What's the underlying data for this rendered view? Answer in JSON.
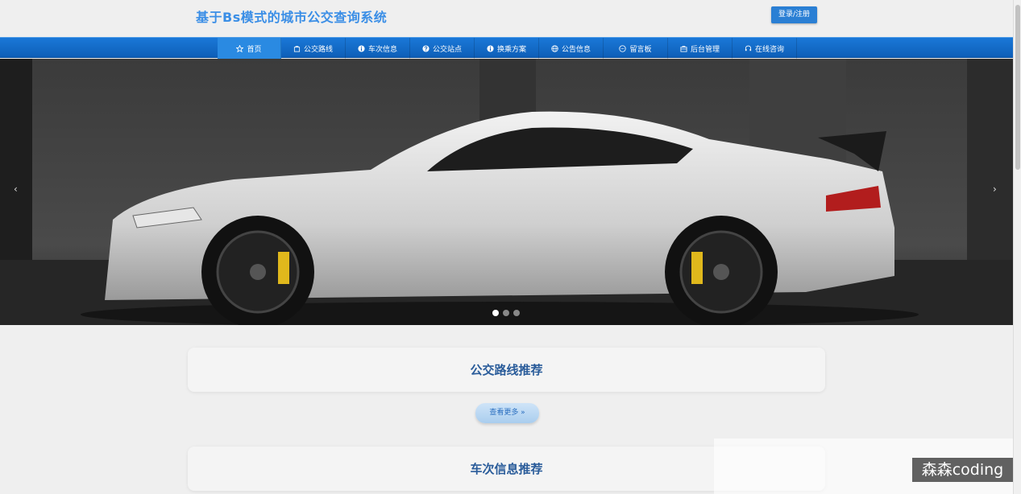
{
  "header": {
    "site_title": "基于Bs模式的城市公交查询系统",
    "login_label": "登录/注册"
  },
  "nav": {
    "items": [
      {
        "label": "首页",
        "icon": "star-icon"
      },
      {
        "label": "公交路线",
        "icon": "bag-icon"
      },
      {
        "label": "车次信息",
        "icon": "info-icon"
      },
      {
        "label": "公交站点",
        "icon": "question-icon"
      },
      {
        "label": "换乘方案",
        "icon": "info-icon"
      },
      {
        "label": "公告信息",
        "icon": "globe-icon"
      },
      {
        "label": "留言板",
        "icon": "chat-icon"
      },
      {
        "label": "后台管理",
        "icon": "briefcase-icon"
      },
      {
        "label": "在线咨询",
        "icon": "headset-icon"
      }
    ]
  },
  "carousel": {
    "prev": "‹",
    "next": "›",
    "slide_count": 3,
    "active_slide": 1
  },
  "sections": [
    {
      "title": "公交路线推荐",
      "more_label": "查看更多 »"
    },
    {
      "title": "车次信息推荐"
    }
  ],
  "watermark": "森森coding",
  "colors": {
    "accent": "#3a8ee6",
    "nav_bg": "#0e5fb8",
    "section_title": "#2a5c9a"
  }
}
